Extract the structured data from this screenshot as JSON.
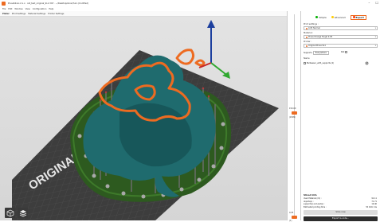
{
  "window": {
    "title": "PrusaSlicer-2.x.x · cat_test_original_SL1.3mf · ~/Desktop/slicer/SL1 (modified)",
    "minimize": "–",
    "close": "☐"
  },
  "menu": [
    "File",
    "Edit",
    "Window",
    "View",
    "Configuration",
    "Help"
  ],
  "tabs": [
    "Plater",
    "Print Settings",
    "Material Settings",
    "Printer Settings"
  ],
  "bed": {
    "brand_text": "ORIGINAL PRUSA SL1"
  },
  "layer_slider": {
    "top_value": "150.00",
    "top_layer": "(2999)",
    "bottom_value": "0.05",
    "bottom_layer": "(1)"
  },
  "sidebar": {
    "modes": [
      {
        "label": "Simple",
        "color": "#00b000"
      },
      {
        "label": "Advanced",
        "color": "#ffcc00"
      },
      {
        "label": "Expert",
        "color": "#ff3300"
      }
    ],
    "print_settings_label": "Print settings :",
    "print_settings_value": "0.05 Normal",
    "material_label": "Material :",
    "material_value": "Prusa Orange Tough 0.05",
    "printer_label": "Printer :",
    "printer_value": "Original Prusa SL1",
    "supports_label": "Supports",
    "supports_value": "Everywhere",
    "pad_label": "Pad",
    "object_name_label": "Name",
    "object_name_value": "Bulbasaur_with_supports (2)",
    "sliced_info_title": "Sliced Info",
    "sliced_info": [
      {
        "label": "Used Material (ml) :",
        "value": "91.11"
      },
      {
        "label": "objects(s) :",
        "value": "71.71"
      },
      {
        "label": "support(s) and pad(s) :",
        "value": "19.40"
      },
      {
        "label": "Estimated printing time :",
        "value": "5h 16m 11s"
      }
    ],
    "slice_now": "Slice now",
    "export_gcode": "Export G-code..."
  },
  "colors": {
    "accent": "#ed6b21",
    "model": "#1f6b6e",
    "pad": "#2d5a1f",
    "bed": "#3d3d3d"
  }
}
